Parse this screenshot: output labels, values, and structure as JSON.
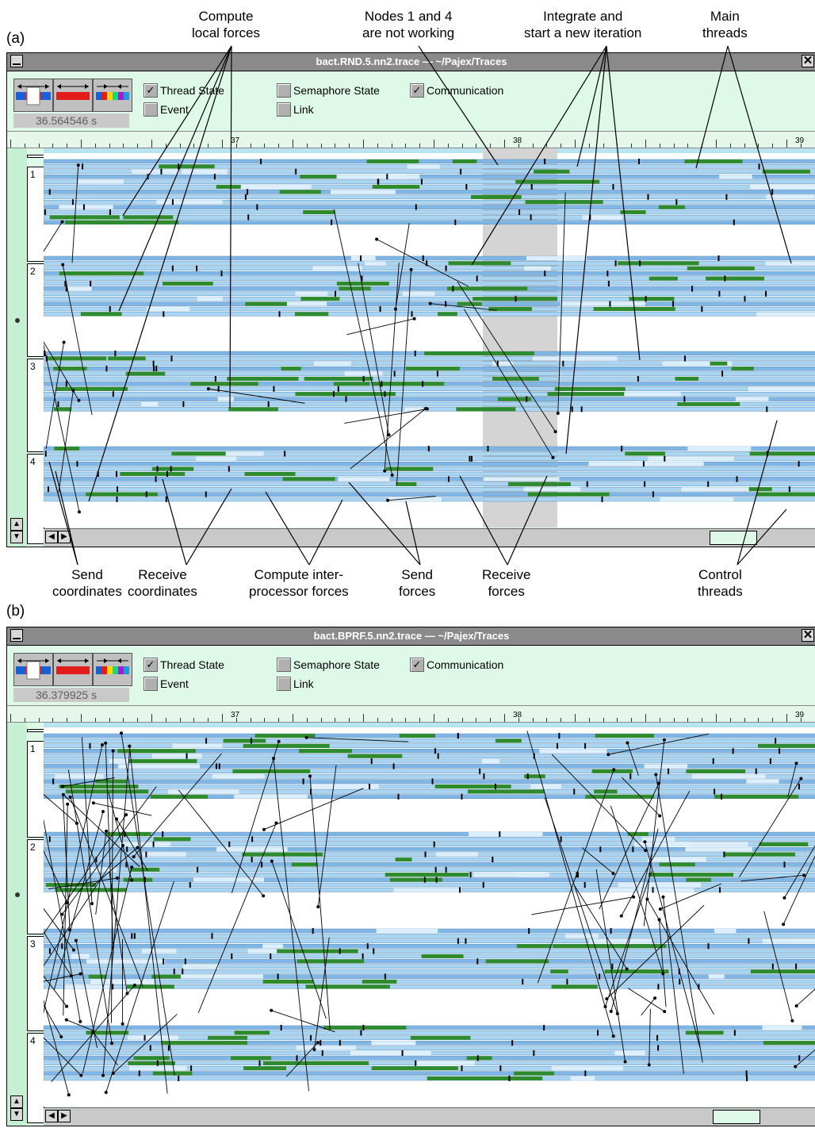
{
  "panel_a_label": "(a)",
  "panel_b_label": "(b)",
  "top_annotations": [
    {
      "l1": "Compute",
      "l2": "local forces"
    },
    {
      "l1": "Nodes 1 and 4",
      "l2": "are not working"
    },
    {
      "l1": "Integrate and",
      "l2": "start a new iteration"
    },
    {
      "l1": "Main",
      "l2": "threads"
    }
  ],
  "bottom_annotations": [
    {
      "l1": "Send",
      "l2": "coordinates"
    },
    {
      "l1": "Receive",
      "l2": "coordinates"
    },
    {
      "l1": "Compute inter-",
      "l2": "processor forces"
    },
    {
      "l1": "Send",
      "l2": "forces"
    },
    {
      "l1": "Receive",
      "l2": "forces"
    },
    {
      "l1": "Control",
      "l2": "threads"
    }
  ],
  "window_a": {
    "title": "bact.RND.5.nn2.trace  —  ~/Pajex/Traces",
    "clock": "36.564546 s",
    "options": {
      "thread_state": "Thread State",
      "event": "Event",
      "semaphore_state": "Semaphore State",
      "link": "Link",
      "communication": "Communication"
    },
    "check_mark": "✓",
    "ruler": [
      "37",
      "38",
      "39"
    ],
    "nodes": [
      "1",
      "2",
      "3",
      "4"
    ]
  },
  "window_b": {
    "title": "bact.BPRF.5.nn2.trace  —  ~/Pajex/Traces",
    "clock": "36.379925 s",
    "options": {
      "thread_state": "Thread State",
      "event": "Event",
      "semaphore_state": "Semaphore State",
      "link": "Link",
      "communication": "Communication"
    },
    "check_mark": "✓",
    "ruler": [
      "37",
      "38",
      "39"
    ],
    "nodes": [
      "1",
      "2",
      "3",
      "4"
    ]
  },
  "colors": {
    "state_light": "#a9d4f2",
    "state_mid": "#7fb6e6",
    "compute_green": "#2e8b2e",
    "idle_gray": "#d4d4d4",
    "window_bg": "#dff9e8"
  }
}
